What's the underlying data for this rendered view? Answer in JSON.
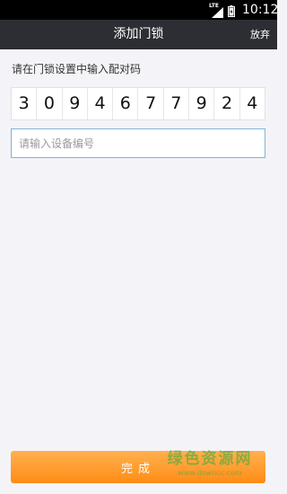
{
  "status_bar": {
    "network": "LTE",
    "time": "10:12"
  },
  "header": {
    "title": "添加门锁",
    "action_label": "放弃"
  },
  "main": {
    "hint": "请在门锁设置中输入配对码",
    "pairing_code": [
      "3",
      "0",
      "9",
      "4",
      "6",
      "7",
      "7",
      "9",
      "2",
      "4"
    ],
    "device_number": {
      "value": "",
      "placeholder": "请输入设备编号"
    }
  },
  "footer": {
    "finish_label": "完成"
  },
  "watermark": {
    "main": "绿色资源网",
    "sub": "www.downcc.com"
  },
  "colors": {
    "title_bar": "#2d2e33",
    "accent_orange": "#ff9a2a",
    "input_border": "#7fb3d8"
  }
}
